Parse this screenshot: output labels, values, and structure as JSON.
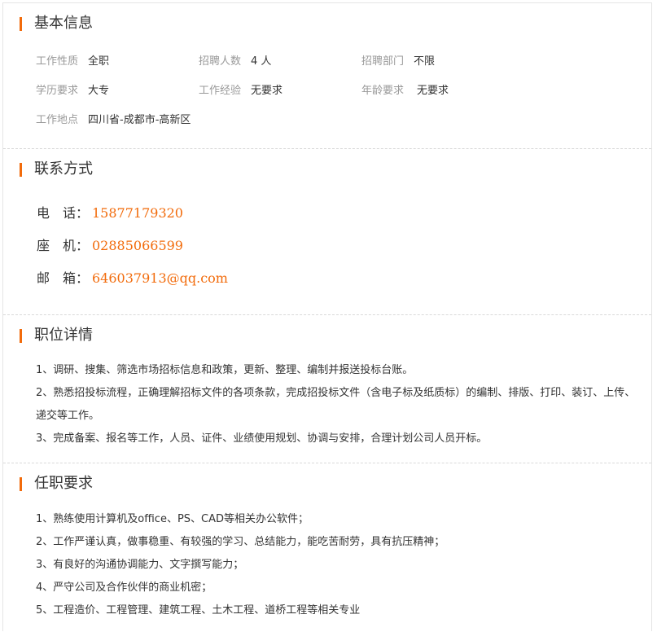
{
  "basic_info": {
    "heading": "基本信息",
    "fields": {
      "nature": {
        "label": "工作性质",
        "value": "全职"
      },
      "headcount": {
        "label": "招聘人数",
        "value": "4 人"
      },
      "department": {
        "label": "招聘部门",
        "value": "不限"
      },
      "education": {
        "label": "学历要求",
        "value": "大专"
      },
      "experience": {
        "label": "工作经验",
        "value": "无要求"
      },
      "age": {
        "label": "年龄要求",
        "value": "无要求"
      },
      "location": {
        "label": "工作地点",
        "value": "四川省-成都市-高新区"
      }
    }
  },
  "contact": {
    "heading": "联系方式",
    "items": [
      {
        "label": "电　话：",
        "value": "15877179320"
      },
      {
        "label": "座　机：",
        "value": "02885066599"
      },
      {
        "label": "邮　箱：",
        "value": "646037913@qq.com"
      }
    ]
  },
  "job_details": {
    "heading": "职位详情",
    "lines": [
      "1、调研、搜集、筛选市场招标信息和政策，更新、整理、编制并报送投标台账。",
      "2、熟悉招投标流程，正确理解招标文件的各项条款，完成招投标文件（含电子标及纸质标）的编制、排版、打印、装订、上传、递交等工作。",
      "3、完成备案、报名等工作，人员、证件、业绩使用规划、协调与安排，合理计划公司人员开标。"
    ]
  },
  "requirements": {
    "heading": "任职要求",
    "lines": [
      "1、熟练使用计算机及office、PS、CAD等相关办公软件；",
      "2、工作严谨认真，做事稳重、有较强的学习、总结能力，能吃苦耐劳，具有抗压精神；",
      "3、有良好的沟通协调能力、文字撰写能力；",
      "4、严守公司及合作伙伴的商业机密；",
      "5、工程造价、工程管理、建筑工程、土木工程、道桥工程等相关专业"
    ]
  },
  "colors": {
    "accent": "#f26b0b",
    "label_gray": "#999999",
    "text": "#333333"
  }
}
